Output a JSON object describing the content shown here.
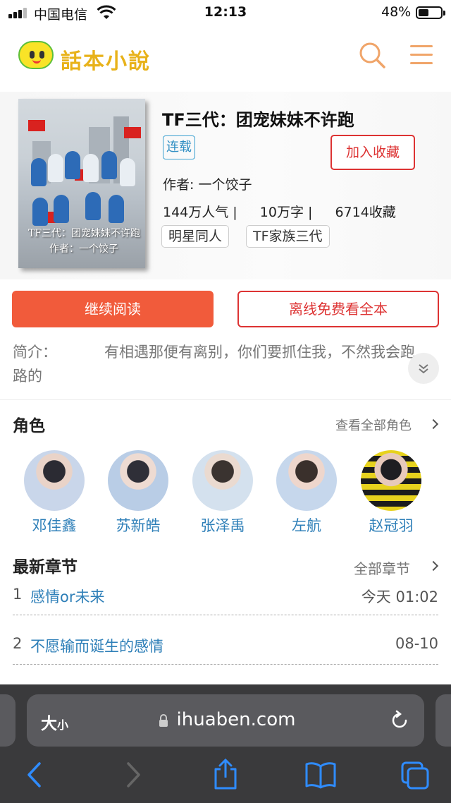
{
  "status_bar": {
    "carrier": "中国电信",
    "time": "12:13",
    "battery": "48%",
    "battery_level": 0.48
  },
  "header": {
    "logo_text": "話本小說",
    "icons": [
      "logo-icon",
      "search-icon",
      "menu-icon"
    ]
  },
  "book": {
    "title": "TF三代：团宠妹妹不许跑",
    "status_tag": "连载",
    "favorite_button": "加入收藏",
    "author": "作者: 一个饺子",
    "stats": {
      "popularity": "144万人气 |",
      "words": "10万字 |",
      "favorites": "6714收藏"
    },
    "genres": [
      "明星同人",
      "TF家族三代"
    ],
    "cover_text": [
      "TF三代：团宠妹妹不许跑",
      "作者：一个饺子"
    ]
  },
  "actions": {
    "continue": "继续阅读",
    "offline": "离线免费看全本"
  },
  "intro": {
    "label": "简介：",
    "text": "有相遇那便有离别，你们要抓住我，不然我会跑路的"
  },
  "roles": {
    "title": "角色",
    "more": "查看全部角色",
    "items": [
      {
        "name": "邓佳鑫"
      },
      {
        "name": "苏新皓"
      },
      {
        "name": "张泽禹"
      },
      {
        "name": "左航"
      },
      {
        "name": "赵冠羽"
      }
    ]
  },
  "chapters": {
    "title": "最新章节",
    "more": "全部章节",
    "items": [
      {
        "num": "1",
        "title": "感情or未来",
        "date": "今天 01:02"
      },
      {
        "num": "2",
        "title": "不愿输而诞生的感情",
        "date": "08-10"
      }
    ]
  },
  "browser": {
    "text_size": "大",
    "text_size_small": "小",
    "url": "ihuaben.com"
  },
  "colors": {
    "accent": "#f15b3b",
    "link": "#2e7fb8",
    "danger": "#dd3333",
    "logo_yellow": "#e8b21a"
  }
}
